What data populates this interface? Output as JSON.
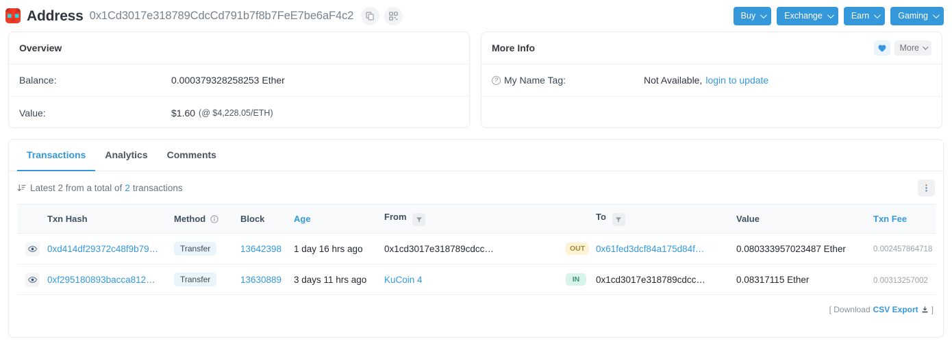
{
  "header": {
    "avatar_icon": "blockie-identicon",
    "title": "Address",
    "address": "0x1Cd3017e318789CdcCd791b7f8b7FeE7be6aF4c2",
    "copy_icon": "copy-icon",
    "qr_icon": "qr-code-icon",
    "buttons": [
      {
        "label": "Buy",
        "name": "buy-button"
      },
      {
        "label": "Exchange",
        "name": "exchange-button"
      },
      {
        "label": "Earn",
        "name": "earn-button"
      },
      {
        "label": "Gaming",
        "name": "gaming-button"
      }
    ],
    "accent_color": "#3498db"
  },
  "overview": {
    "title": "Overview",
    "balance_label": "Balance:",
    "balance_value": "0.000379328258253 Ether",
    "value_label": "Value:",
    "value_amount": "$1.60",
    "value_rate": "(@ $4,228.05/ETH)"
  },
  "more_info": {
    "title": "More Info",
    "heart_icon": "heart-icon",
    "more_label": "More",
    "name_tag_label": "My Name Tag:",
    "name_tag_value": "Not Available,",
    "name_tag_link": "login to update",
    "help_icon": "question-mark-icon"
  },
  "tabs": [
    {
      "label": "Transactions",
      "name": "tab-transactions",
      "active": true
    },
    {
      "label": "Analytics",
      "name": "tab-analytics",
      "active": false
    },
    {
      "label": "Comments",
      "name": "tab-comments",
      "active": false
    }
  ],
  "count_row": {
    "sort_icon": "sort-descending-icon",
    "prefix": "Latest 2 from a total of",
    "total_link": "2",
    "suffix": "transactions",
    "kebab_icon": "more-vertical-icon"
  },
  "table": {
    "columns": [
      {
        "label": "",
        "name": "col-eye"
      },
      {
        "label": "Txn Hash",
        "name": "col-txn-hash"
      },
      {
        "label": "Method",
        "name": "col-method",
        "info_icon": "info-circle-icon"
      },
      {
        "label": "Block",
        "name": "col-block"
      },
      {
        "label": "Age",
        "name": "col-age",
        "blue": true
      },
      {
        "label": "From",
        "name": "col-from",
        "filter_icon": "filter-icon"
      },
      {
        "label": "",
        "name": "col-direction"
      },
      {
        "label": "To",
        "name": "col-to",
        "filter_icon": "filter-icon"
      },
      {
        "label": "Value",
        "name": "col-value"
      },
      {
        "label": "Txn Fee",
        "name": "col-txn-fee",
        "blue": true
      }
    ],
    "rows": [
      {
        "eye_icon": "eye-icon",
        "txn_hash": "0xd414df29372c48f9b79…",
        "method": "Transfer",
        "block": "13642398",
        "age": "1 day 16 hrs ago",
        "from": "0x1cd3017e318789cdcc…",
        "from_is_link": false,
        "direction": "OUT",
        "to": "0x61fed3dcf84a175d84f…",
        "to_is_link": true,
        "value": "0.080333957023487 Ether",
        "fee": "0.002457864718",
        "fee_icon": "gas-bulb-icon"
      },
      {
        "eye_icon": "eye-icon",
        "txn_hash": "0xf295180893bacca812…",
        "method": "Transfer",
        "block": "13630889",
        "age": "3 days 11 hrs ago",
        "from": "KuCoin 4",
        "from_is_link": true,
        "direction": "IN",
        "to": "0x1cd3017e318789cdcc…",
        "to_is_link": false,
        "value": "0.08317115 Ether",
        "fee": "0.00313257002",
        "fee_icon": ""
      }
    ]
  },
  "footer": {
    "open": "[ Download",
    "link": "CSV Export",
    "download_icon": "download-icon",
    "close": "]"
  }
}
